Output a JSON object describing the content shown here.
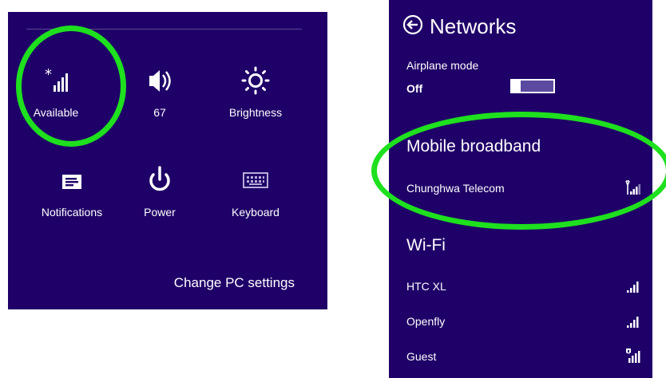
{
  "settings_panel": {
    "tiles": [
      {
        "label": "Available",
        "icon": "signal-available-icon"
      },
      {
        "label": "67",
        "icon": "volume-icon"
      },
      {
        "label": "Brightness",
        "icon": "brightness-icon"
      },
      {
        "label": "Notifications",
        "icon": "notifications-icon"
      },
      {
        "label": "Power",
        "icon": "power-icon"
      },
      {
        "label": "Keyboard",
        "icon": "keyboard-icon"
      }
    ],
    "change_pc_settings": "Change PC settings"
  },
  "networks_panel": {
    "title": "Networks",
    "airplane_mode": {
      "label": "Airplane mode",
      "state": "Off"
    },
    "mobile_broadband": {
      "heading": "Mobile broadband",
      "items": [
        {
          "name": "Chunghwa Telecom",
          "icon": "mobile-signal-icon"
        }
      ]
    },
    "wifi": {
      "heading": "Wi-Fi",
      "items": [
        {
          "name": "HTC XL",
          "icon": "wifi-signal-icon"
        },
        {
          "name": "Openfly",
          "icon": "wifi-signal-icon"
        },
        {
          "name": "Guest",
          "icon": "wifi-secured-signal-icon"
        }
      ]
    }
  },
  "colors": {
    "panel_background": "#1f0068",
    "annotation_highlight": "#1ee01e",
    "text": "#ffffff"
  }
}
